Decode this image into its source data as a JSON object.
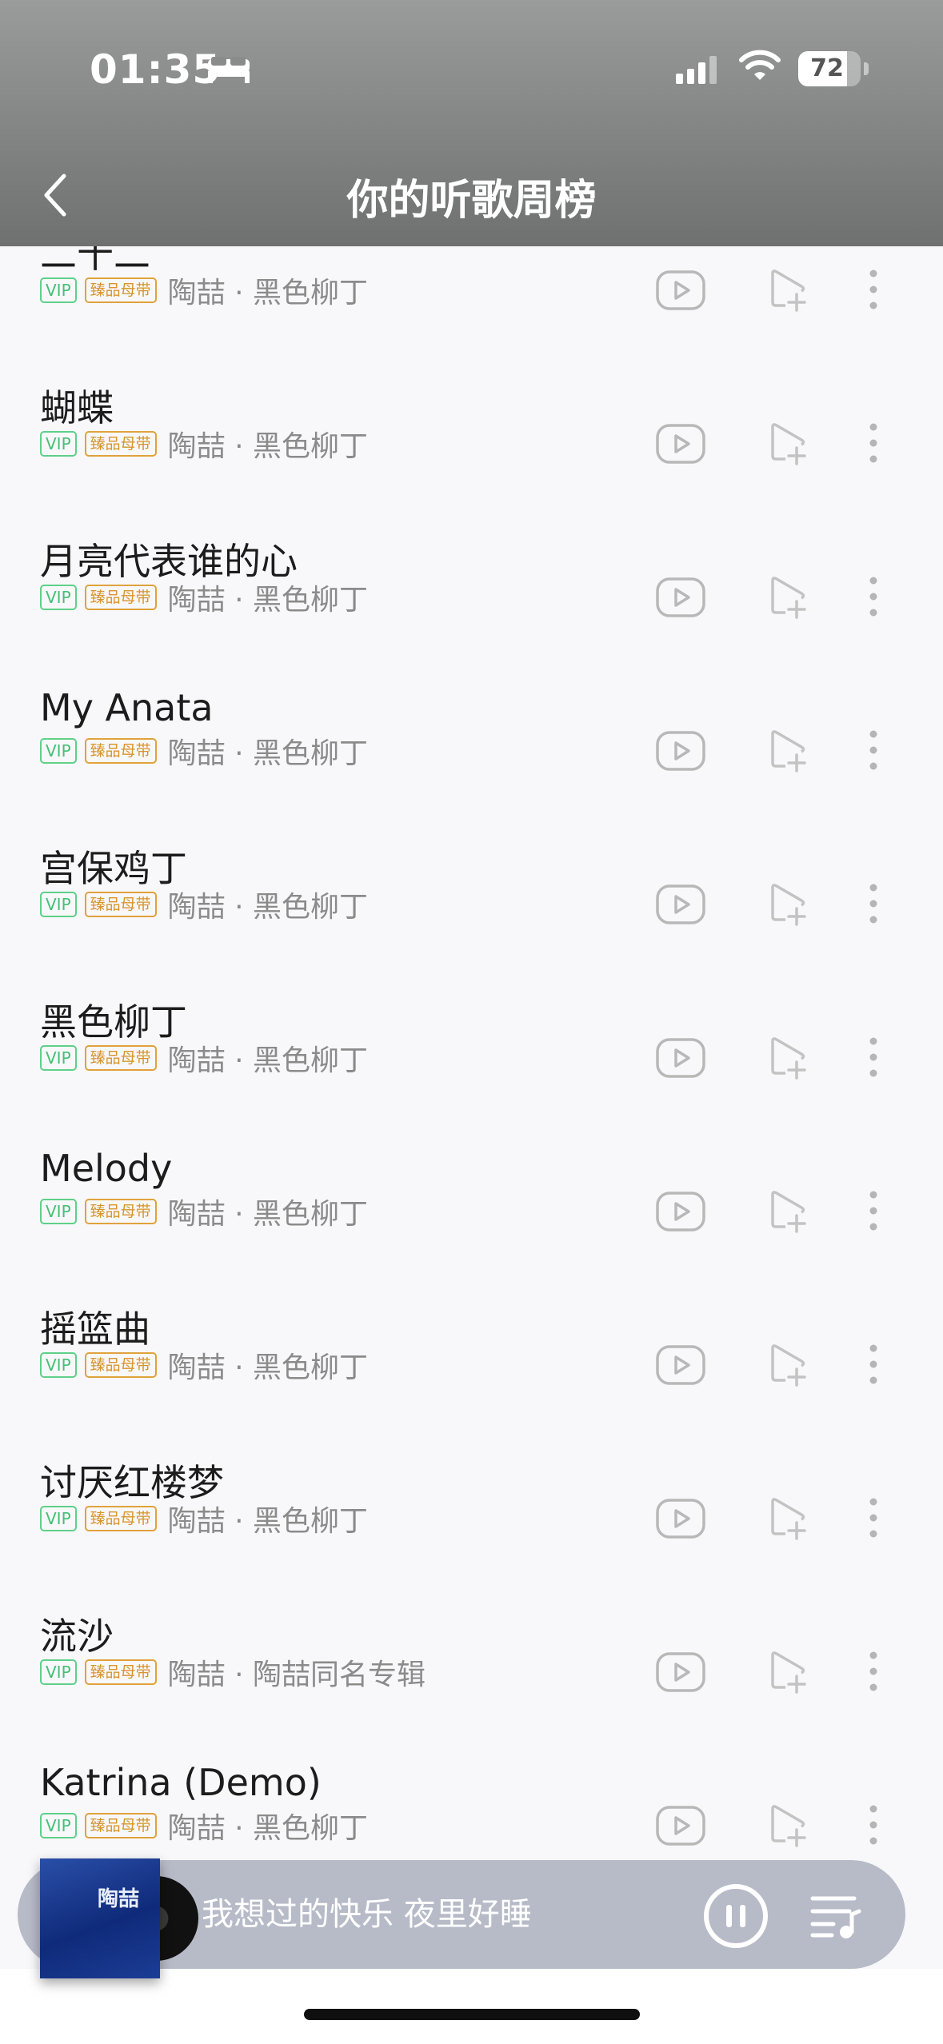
{
  "status_bar": {
    "time": "01:35",
    "battery": "72"
  },
  "nav": {
    "title": "你的听歌周榜"
  },
  "tags": {
    "vip": "VIP",
    "master": "臻品母带"
  },
  "songs": [
    {
      "title": "二十二",
      "artist": "陶喆 · 黑色柳丁"
    },
    {
      "title": "蝴蝶",
      "artist": "陶喆 · 黑色柳丁"
    },
    {
      "title": "月亮代表谁的心",
      "artist": "陶喆 · 黑色柳丁"
    },
    {
      "title": "My Anata",
      "artist": "陶喆 · 黑色柳丁"
    },
    {
      "title": "宫保鸡丁",
      "artist": "陶喆 · 黑色柳丁"
    },
    {
      "title": "黑色柳丁",
      "artist": "陶喆 · 黑色柳丁"
    },
    {
      "title": "Melody",
      "artist": "陶喆 · 黑色柳丁"
    },
    {
      "title": "摇篮曲",
      "artist": "陶喆 · 黑色柳丁"
    },
    {
      "title": "讨厌红楼梦",
      "artist": "陶喆 · 黑色柳丁"
    },
    {
      "title": "流沙",
      "artist": "陶喆 · 陶喆同名专辑"
    },
    {
      "title": "Katrina (Demo)",
      "artist": "陶喆 · 黑色柳丁"
    }
  ],
  "player": {
    "now_playing": "我想过的快乐 夜里好睡",
    "cover_text": "陶喆"
  },
  "icons": {
    "row": [
      "play-icon",
      "add-to-playlist-icon",
      "more-icon"
    ],
    "player": [
      "pause-icon",
      "playlist-icon"
    ]
  }
}
